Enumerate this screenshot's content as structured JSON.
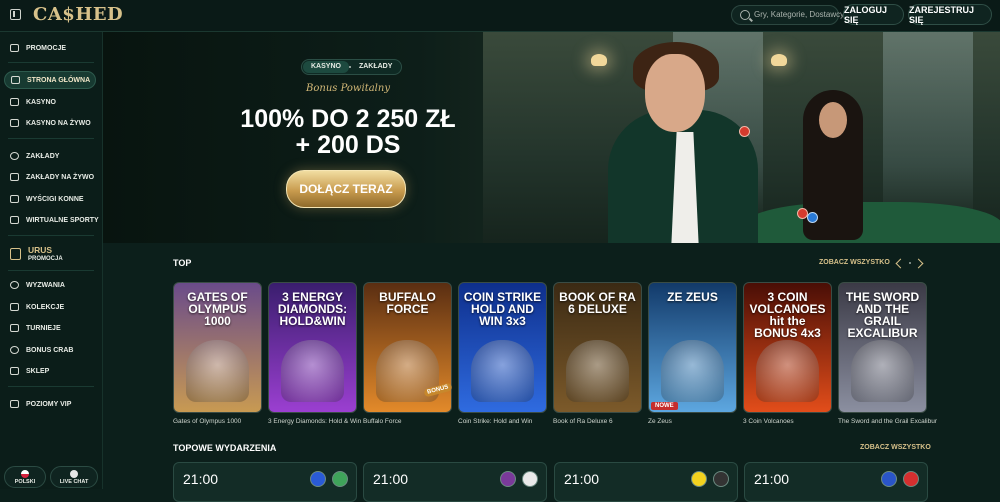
{
  "header": {
    "logo": "CA$HED",
    "search_placeholder": "Gry, Kategorie, Dostawcy",
    "login_label": "ZALOGUJ SIĘ",
    "register_label": "ZAREJESTRUJ SIĘ"
  },
  "sidebar": {
    "items": [
      {
        "label": "PROMOCJE",
        "icon": "gift-icon"
      },
      {
        "label": "STRONA GŁÓWNA",
        "icon": "home-icon",
        "active": true
      },
      {
        "label": "KASYNO",
        "icon": "slot-machine-icon"
      },
      {
        "label": "KASYNO NA ŻYWO",
        "icon": "live-cards-icon"
      },
      {
        "label": "ZAKŁADY",
        "icon": "football-icon"
      },
      {
        "label": "ZAKŁADY NA ŻYWO",
        "icon": "live-tv-icon"
      },
      {
        "label": "WYŚCIGI KONNE",
        "icon": "horse-icon"
      },
      {
        "label": "WIRTUALNE SPORTY",
        "icon": "virtual-sports-icon"
      },
      {
        "label": "WYZWANIA",
        "icon": "target-icon"
      },
      {
        "label": "KOLEKCJE",
        "icon": "collections-icon"
      },
      {
        "label": "TURNIEJE",
        "icon": "trophy-icon"
      },
      {
        "label": "BONUS CRAB",
        "icon": "crab-icon"
      },
      {
        "label": "SKLEP",
        "icon": "shop-icon"
      },
      {
        "label": "POZIOMY VIP",
        "icon": "vip-icon"
      }
    ],
    "urus": {
      "title": "URUS",
      "subtitle": "PROMOCJA",
      "icon": "lamborghini-icon"
    },
    "language_label": "POLSKI",
    "chat_label": "LIVE CHAT"
  },
  "hero": {
    "tabs": [
      {
        "label": "KASYNO",
        "active": true
      },
      {
        "label": "ZAKŁADY",
        "active": false
      }
    ],
    "bonus_label": "Bonus Powitalny",
    "headline_line1": "100% DO 2 250 ZŁ",
    "headline_line2": "+ 200 DS",
    "cta_label": "DOŁĄCZ TERAZ"
  },
  "top_section": {
    "title": "TOP",
    "see_all": "ZOBACZ WSZYSTKO",
    "games": [
      {
        "name": "Gates of Olympus 1000",
        "art_title": "GATES OF OLYMPUS 1000",
        "colors": [
          "#6a4b8a",
          "#c89a52"
        ]
      },
      {
        "name": "3 Energy Diamonds: Hold & Win",
        "art_title": "3 ENERGY DIAMONDS: HOLD&WIN",
        "colors": [
          "#3a1e6e",
          "#9b3fd1"
        ]
      },
      {
        "name": "Buffalo Force",
        "art_title": "BUFFALO FORCE",
        "colors": [
          "#5a2e12",
          "#e38a2a"
        ]
      },
      {
        "name": "Coin Strike: Hold and Win",
        "art_title": "COIN STRIKE HOLD AND WIN 3x3",
        "colors": [
          "#0e2f8c",
          "#2f6be0"
        ]
      },
      {
        "name": "Book of Ra Deluxe 6",
        "art_title": "BOOK OF RA 6 DELUXE",
        "colors": [
          "#3b2a14",
          "#7c5a2a"
        ]
      },
      {
        "name": "Ze Zeus",
        "art_title": "ZE ZEUS",
        "colors": [
          "#123a6a",
          "#5da7e0"
        ],
        "badge": "NOWE"
      },
      {
        "name": "3 Coin Volcanoes",
        "art_title": "3 COIN VOLCANOES hit the BONUS 4x3",
        "colors": [
          "#4a0e06",
          "#e24d1a"
        ]
      },
      {
        "name": "The Sword and the Grail Excalibur",
        "art_title": "THE SWORD AND THE GRAIL EXCALIBUR",
        "colors": [
          "#3b3a46",
          "#8b8fa0"
        ]
      }
    ],
    "bonus_badge": "BONUS"
  },
  "events_section": {
    "title": "TOPOWE WYDARZENIA",
    "see_all": "ZOBACZ WSZYSTKO",
    "events": [
      {
        "time": "21:00",
        "jerseys": [
          "#2a5bd6",
          "#3fa35a"
        ]
      },
      {
        "time": "21:00",
        "jerseys": [
          "#7a3a9a",
          "#e9e9e9"
        ]
      },
      {
        "time": "21:00",
        "jerseys": [
          "#f2d21f",
          "#333333"
        ]
      },
      {
        "time": "21:00",
        "jerseys": [
          "#2a55c8",
          "#d52f2f"
        ]
      }
    ]
  }
}
